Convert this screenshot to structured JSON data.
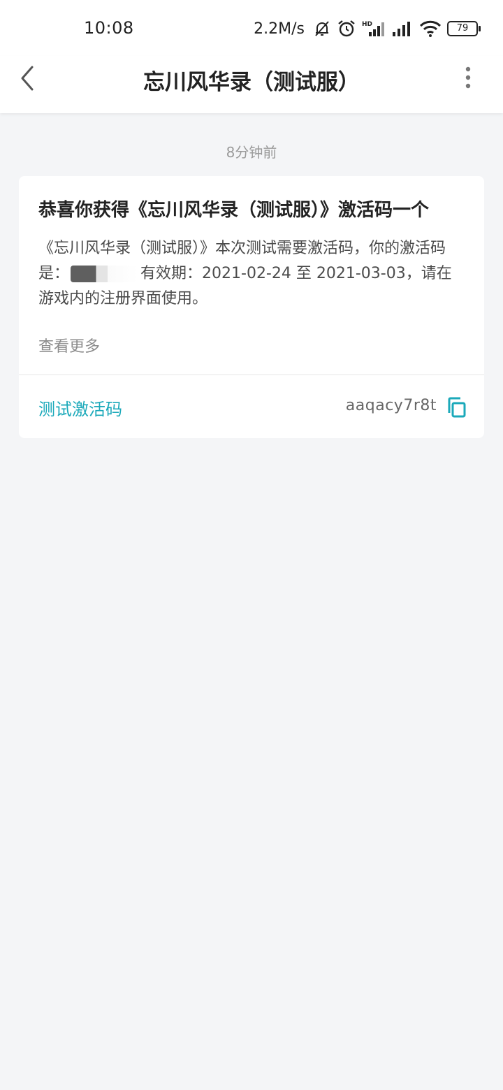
{
  "status_bar": {
    "time": "10:08",
    "net_speed": "2.2M/s",
    "battery": "79",
    "icons": [
      "bell-muted-icon",
      "alarm-icon",
      "hd-signal-icon",
      "signal-icon",
      "wifi-icon",
      "battery-icon"
    ]
  },
  "header": {
    "title": "忘川风华录（测试服）",
    "back_icon": "chevron-left-icon",
    "more_icon": "more-vertical-icon"
  },
  "message": {
    "time": "8分钟前",
    "title": "恭喜你获得《忘川风华录（测试服）》激活码一个",
    "body_part1": "《忘川风华录（测试服）》本次测试需要激活码，你的激活码是：",
    "body_part2": "有效期：2021-02-24 至 2021-03-03，请在游戏内的注册界面使用。",
    "see_more": "查看更多",
    "code_label": "测试激活码",
    "code_value": "aaqacy7r8t",
    "copy_icon": "copy-icon"
  },
  "colors": {
    "accent": "#1ba9ba",
    "background": "#f4f5f7",
    "card": "#ffffff",
    "text_primary": "#222222",
    "text_secondary": "#4b4b4b",
    "text_hint": "#9a9a9a"
  }
}
